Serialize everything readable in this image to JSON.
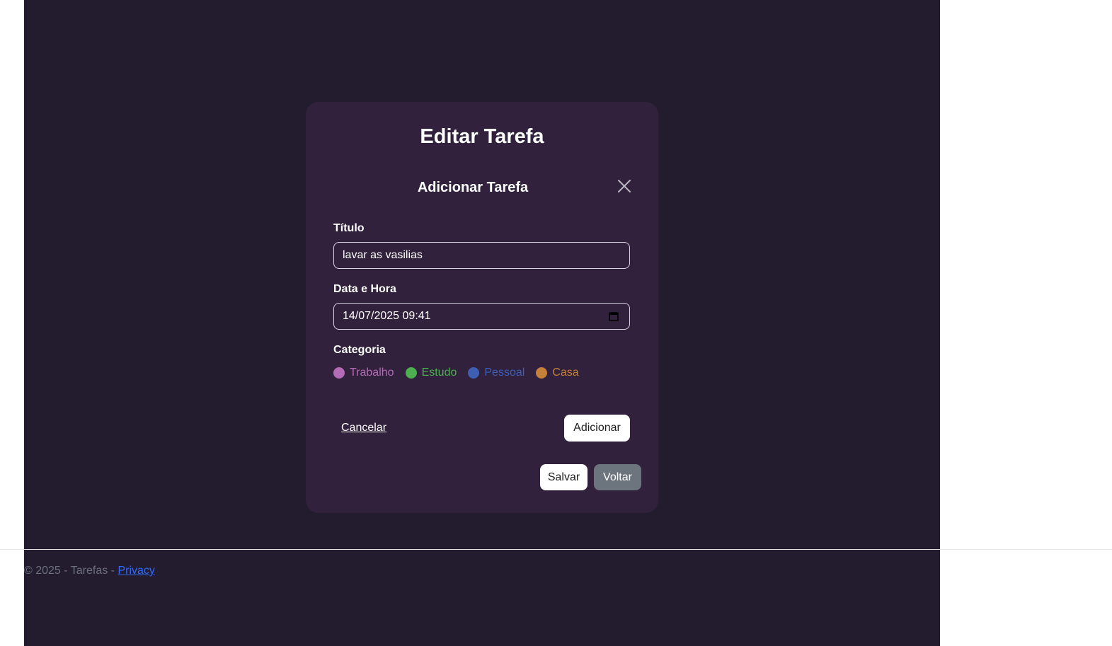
{
  "page": {
    "card_title": "Editar Tarefa"
  },
  "modal": {
    "title": "Adicionar Tarefa",
    "close_icon": "close-icon",
    "fields": {
      "title_label": "Título",
      "title_value": "lavar as vasilias",
      "datetime_label": "Data e Hora",
      "datetime_value": "14/07/2025 09:41",
      "datetime_icon": "calendar-icon",
      "category_label": "Categoria"
    },
    "categories": [
      {
        "label": "Trabalho",
        "color": "#b36bb5"
      },
      {
        "label": "Estudo",
        "color": "#4caf50"
      },
      {
        "label": "Pessoal",
        "color": "#3f5fb5"
      },
      {
        "label": "Casa",
        "color": "#c5803a"
      }
    ],
    "cancel_label": "Cancelar",
    "add_label": "Adicionar"
  },
  "actions": {
    "save_label": "Salvar",
    "back_label": "Voltar"
  },
  "footer": {
    "text": "© 2025 - Tarefas - ",
    "privacy_label": "Privacy"
  },
  "colors": {
    "app_background": "#231c2f",
    "card_background": "#31213c",
    "link": "#2f6bff"
  }
}
